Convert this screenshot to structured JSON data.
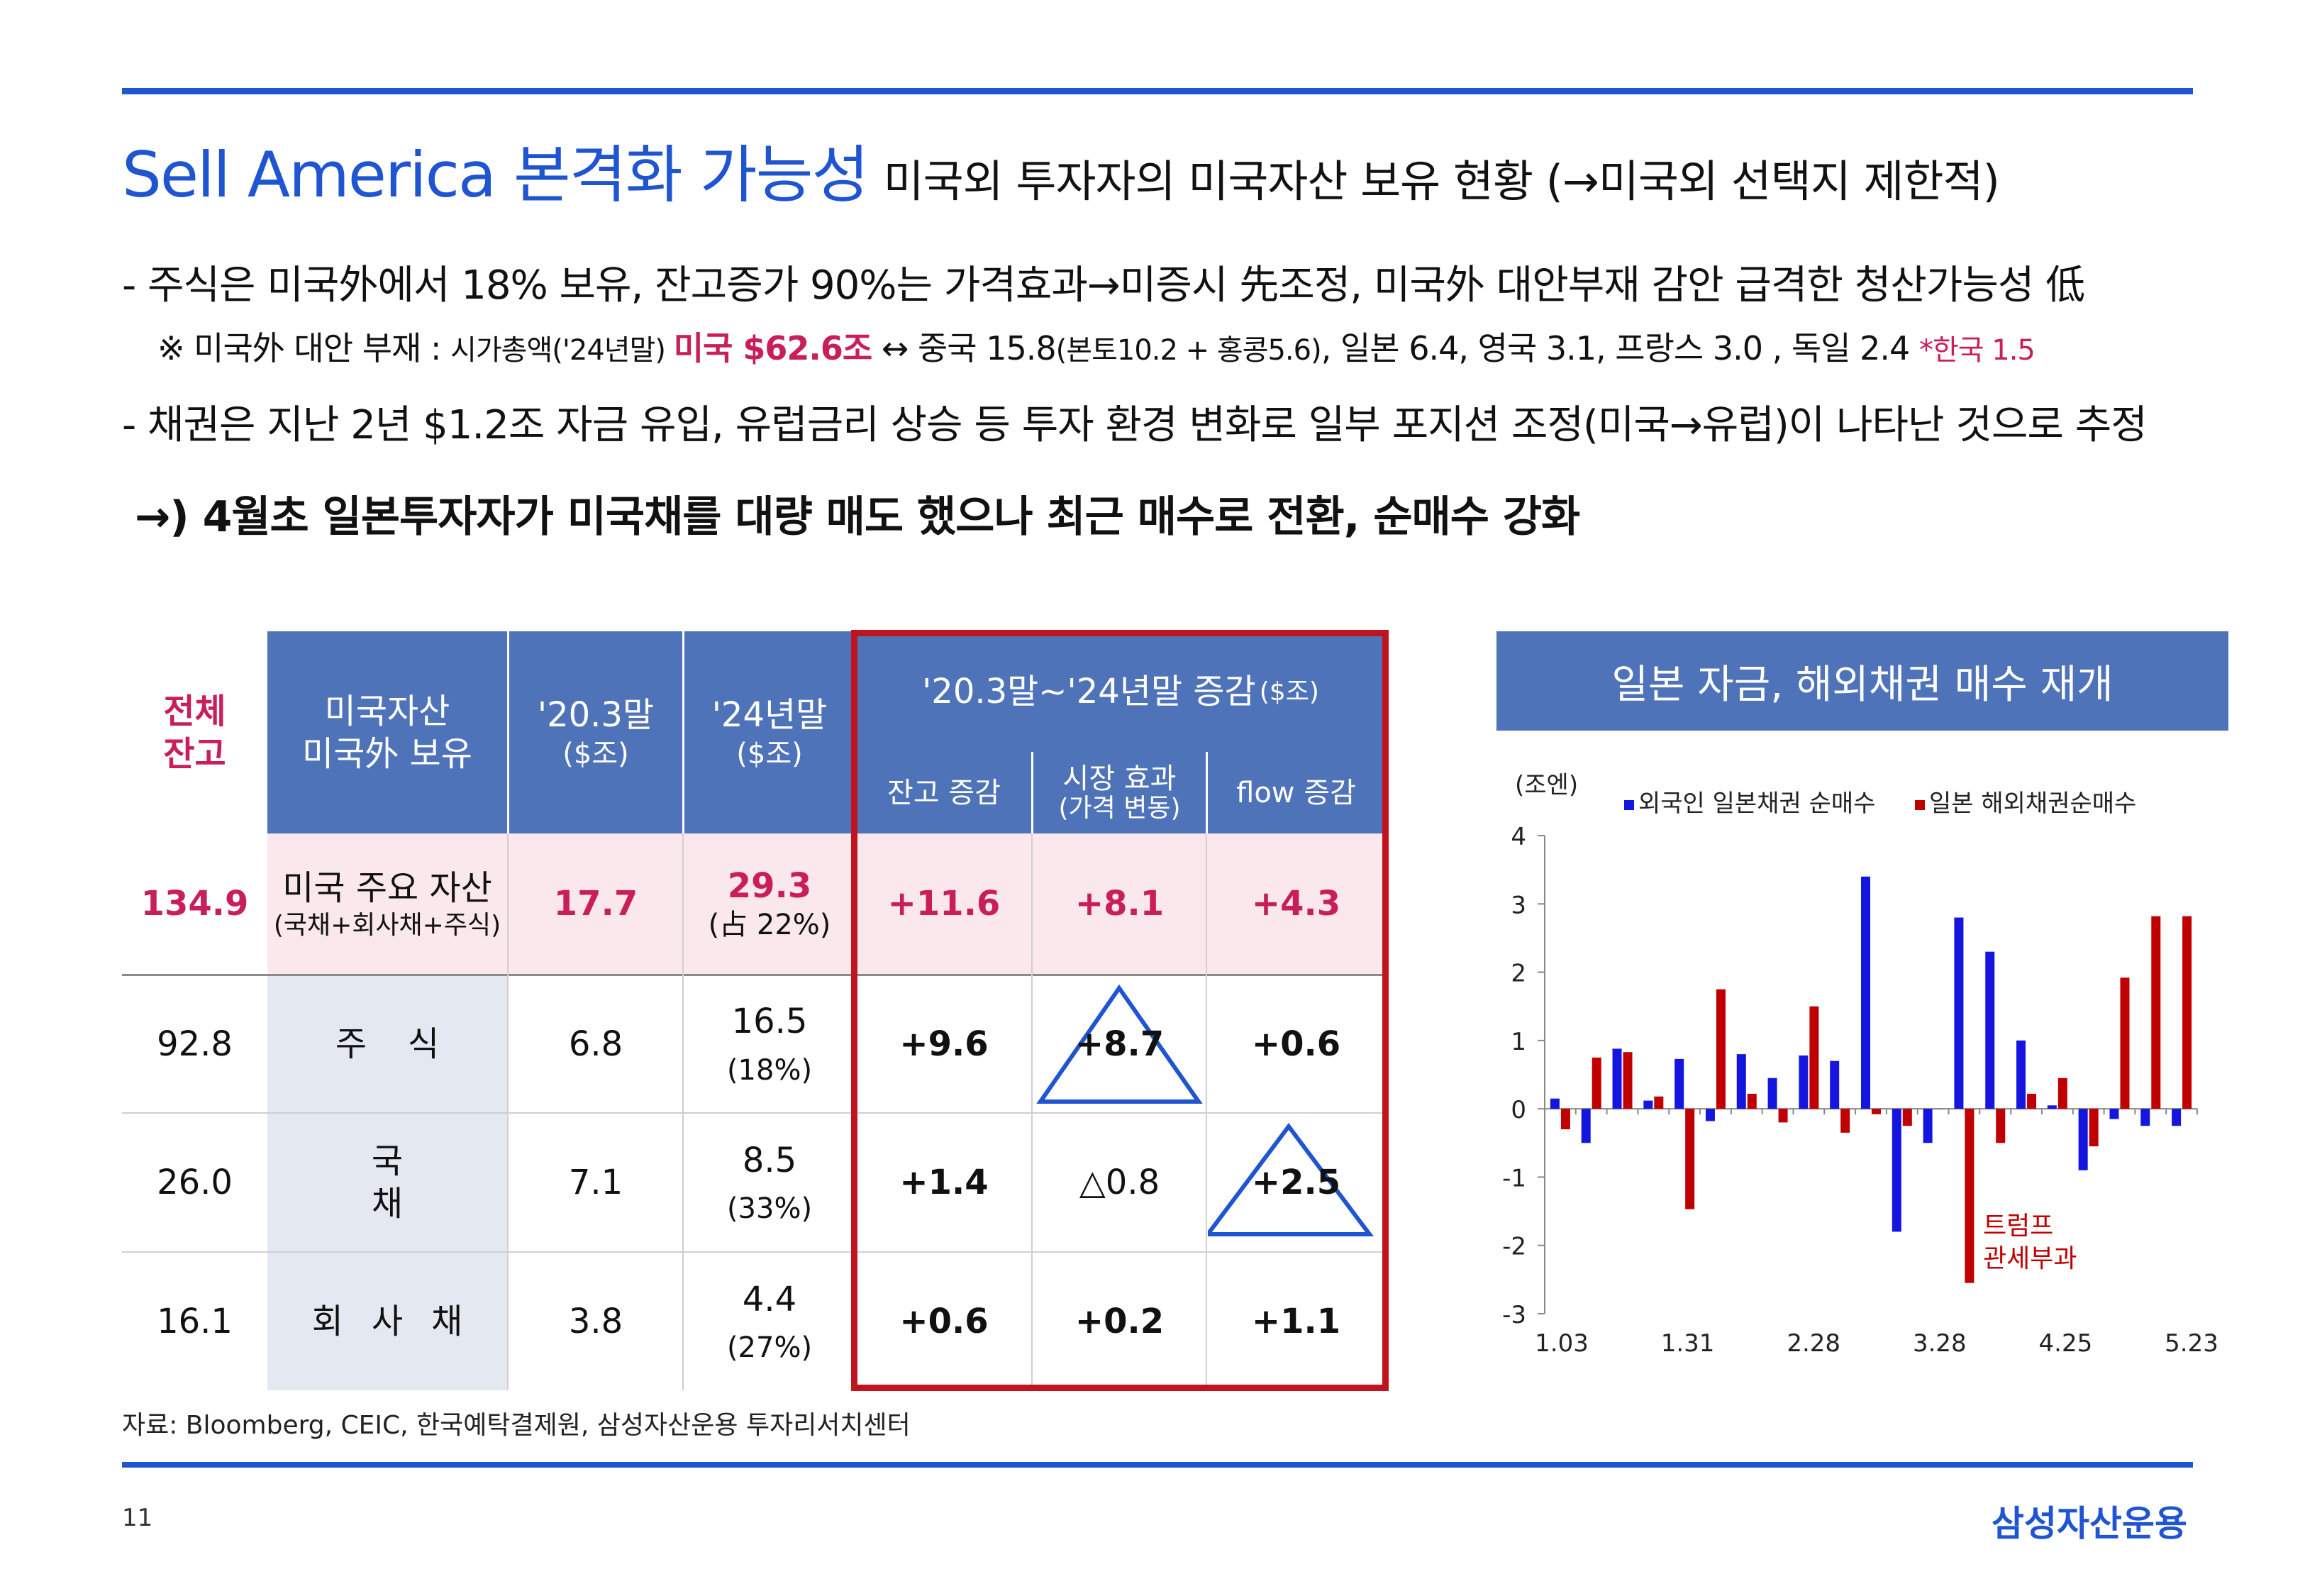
{
  "title": {
    "main": "Sell America 본격화 가능성",
    "sub": "미국외 투자자의 미국자산 보유 현황 (→미국외 선택지 제한적)"
  },
  "bullets": {
    "l1": "- 주식은 미국外에서 18% 보유, 잔고증가 90%는 가격효과→미증시 先조정, 미국外 대안부재 감안 급격한 청산가능성 低",
    "l2_a": "※ 미국外 대안 부재 : ",
    "l2_b": "시가총액('24년말) ",
    "l2_c": "미국 $62.6조",
    "l2_d": " ↔ 중국 15.8",
    "l2_e": "(본토10.2 + 홍콩5.6)",
    "l2_f": ", 일본 6.4, 영국 3.1, 프랑스 3.0 , 독일 2.4 ",
    "l2_g": "*한국 1.5",
    "l3": "- 채권은 지난 2년 $1.2조 자금 유입, 유럽금리 상승 등 투자 환경 변화로 일부 포지션 조정(미국→유럽)이 나타난 것으로 추정",
    "l4": "→) 4월초 일본투자자가 미국채를 대량 매도 했으나 최근 매수로 전환, 순매수 강화"
  },
  "table": {
    "headers": {
      "total": "전체\n잔고",
      "asset_1": "미국자산",
      "asset_2": "미국外 보유",
      "y2020_1": "'20.3말",
      "y2020_2": "($조)",
      "y2024_1": "'24년말",
      "y2024_2": "($조)",
      "change": "'20.3말~'24년말 증감",
      "change_unit": "($조)",
      "balance": "잔고 증감",
      "market_1": "시장 효과",
      "market_2": "(가격 변동)",
      "flow": "flow 증감"
    },
    "rows": [
      {
        "total": "134.9",
        "name": "미국 주요 자산",
        "name_sub": "(국채+회사채+주식)",
        "v2020": "17.7",
        "v2024": "29.3",
        "v2024_sub": "(占 22%)",
        "balance": "+11.6",
        "market": "+8.1",
        "flow": "+4.3"
      },
      {
        "total": "92.8",
        "name": "주식",
        "name_sub": "",
        "v2020": "6.8",
        "v2024": "16.5",
        "v2024_sub": "(18%)",
        "balance": "+9.6",
        "market": "+8.7",
        "flow": "+0.6"
      },
      {
        "total": "26.0",
        "name": "국채",
        "name_sub": "",
        "v2020": "7.1",
        "v2024": "8.5",
        "v2024_sub": "(33%)",
        "balance": "+1.4",
        "market": "△0.8",
        "flow": "+2.5"
      },
      {
        "total": "16.1",
        "name": "회사채",
        "name_sub": "",
        "v2020": "3.8",
        "v2024": "4.4",
        "v2024_sub": "(27%)",
        "balance": "+0.6",
        "market": "+0.2",
        "flow": "+1.1"
      }
    ]
  },
  "source": "자료: Bloomberg, CEIC, 한국예탁결제원, 삼성자산운용 투자리서치센터",
  "page_number": "11",
  "logo": "삼성자산운용",
  "colors": {
    "brand_blue": "#1f55d0",
    "header_blue": "#4f73b8",
    "highlight_red": "#c0141e",
    "accent_pink": "#c81e5a",
    "series_blue": "#1515e0",
    "series_red": "#c00000"
  },
  "chart_data": {
    "type": "bar",
    "title": "일본 자금, 해외채권 매수 재개",
    "ylabel": "(조엔)",
    "ylim": [
      -3,
      4
    ],
    "yticks": [
      "4",
      "3",
      "2",
      "1",
      "0",
      "-1",
      "-2",
      "-3"
    ],
    "x_tick_labels": [
      "1.03",
      "1.31",
      "2.28",
      "3.28",
      "4.25",
      "5.23"
    ],
    "legend_position": "top",
    "annotation": "트럼프\n관세부과",
    "series": [
      {
        "name": "외국인 일본채권 순매수",
        "color": "#1515e0",
        "values": [
          0.15,
          -0.5,
          0.88,
          0.12,
          0.73,
          -0.18,
          0.8,
          0.45,
          0.78,
          0.7,
          3.4,
          -1.8,
          -0.5,
          2.8,
          2.3,
          1.0,
          0.05,
          -0.9,
          -0.15,
          -0.25,
          -0.25
        ]
      },
      {
        "name": "일본 해외채권순매수",
        "color": "#c00000",
        "values": [
          -0.3,
          0.75,
          0.83,
          0.18,
          -1.47,
          1.75,
          0.22,
          -0.2,
          1.5,
          -0.35,
          -0.08,
          -0.25,
          0.0,
          -2.55,
          -0.5,
          0.22,
          0.45,
          -0.55,
          1.92,
          2.82,
          2.82
        ]
      }
    ]
  }
}
